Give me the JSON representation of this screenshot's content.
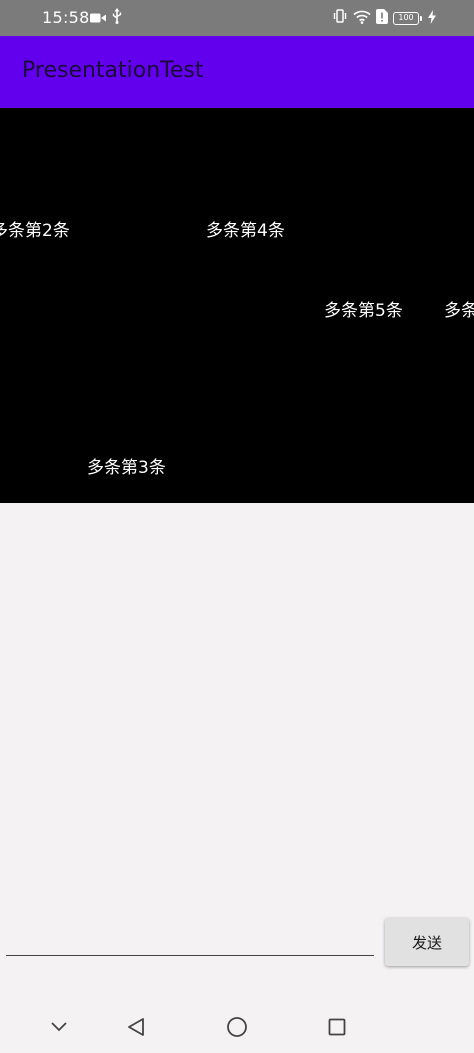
{
  "status_bar": {
    "time": "15:58",
    "battery": "100",
    "icons": [
      "video-camera-icon",
      "usb-icon",
      "vibrate-icon",
      "wifi-icon",
      "sim-alert-icon",
      "battery-icon",
      "charging-icon"
    ]
  },
  "app_bar": {
    "title": "PresentationTest"
  },
  "danmaku": {
    "items": [
      "多条第2条",
      "多条第4条",
      "多条第5条",
      "多条",
      "多条第3条"
    ]
  },
  "composer": {
    "input_value": "",
    "send_label": "发送"
  },
  "nav_bar": {
    "icons": [
      "chevron-down-icon",
      "back-triangle-icon",
      "home-circle-icon",
      "recent-square-icon"
    ]
  },
  "colors": {
    "status_bar": "#7b7b7b",
    "app_bar": "#6200ee",
    "danmaku_bg": "#000000",
    "page_bg": "#f4f2f3",
    "send_button": "#e2e1e1"
  }
}
